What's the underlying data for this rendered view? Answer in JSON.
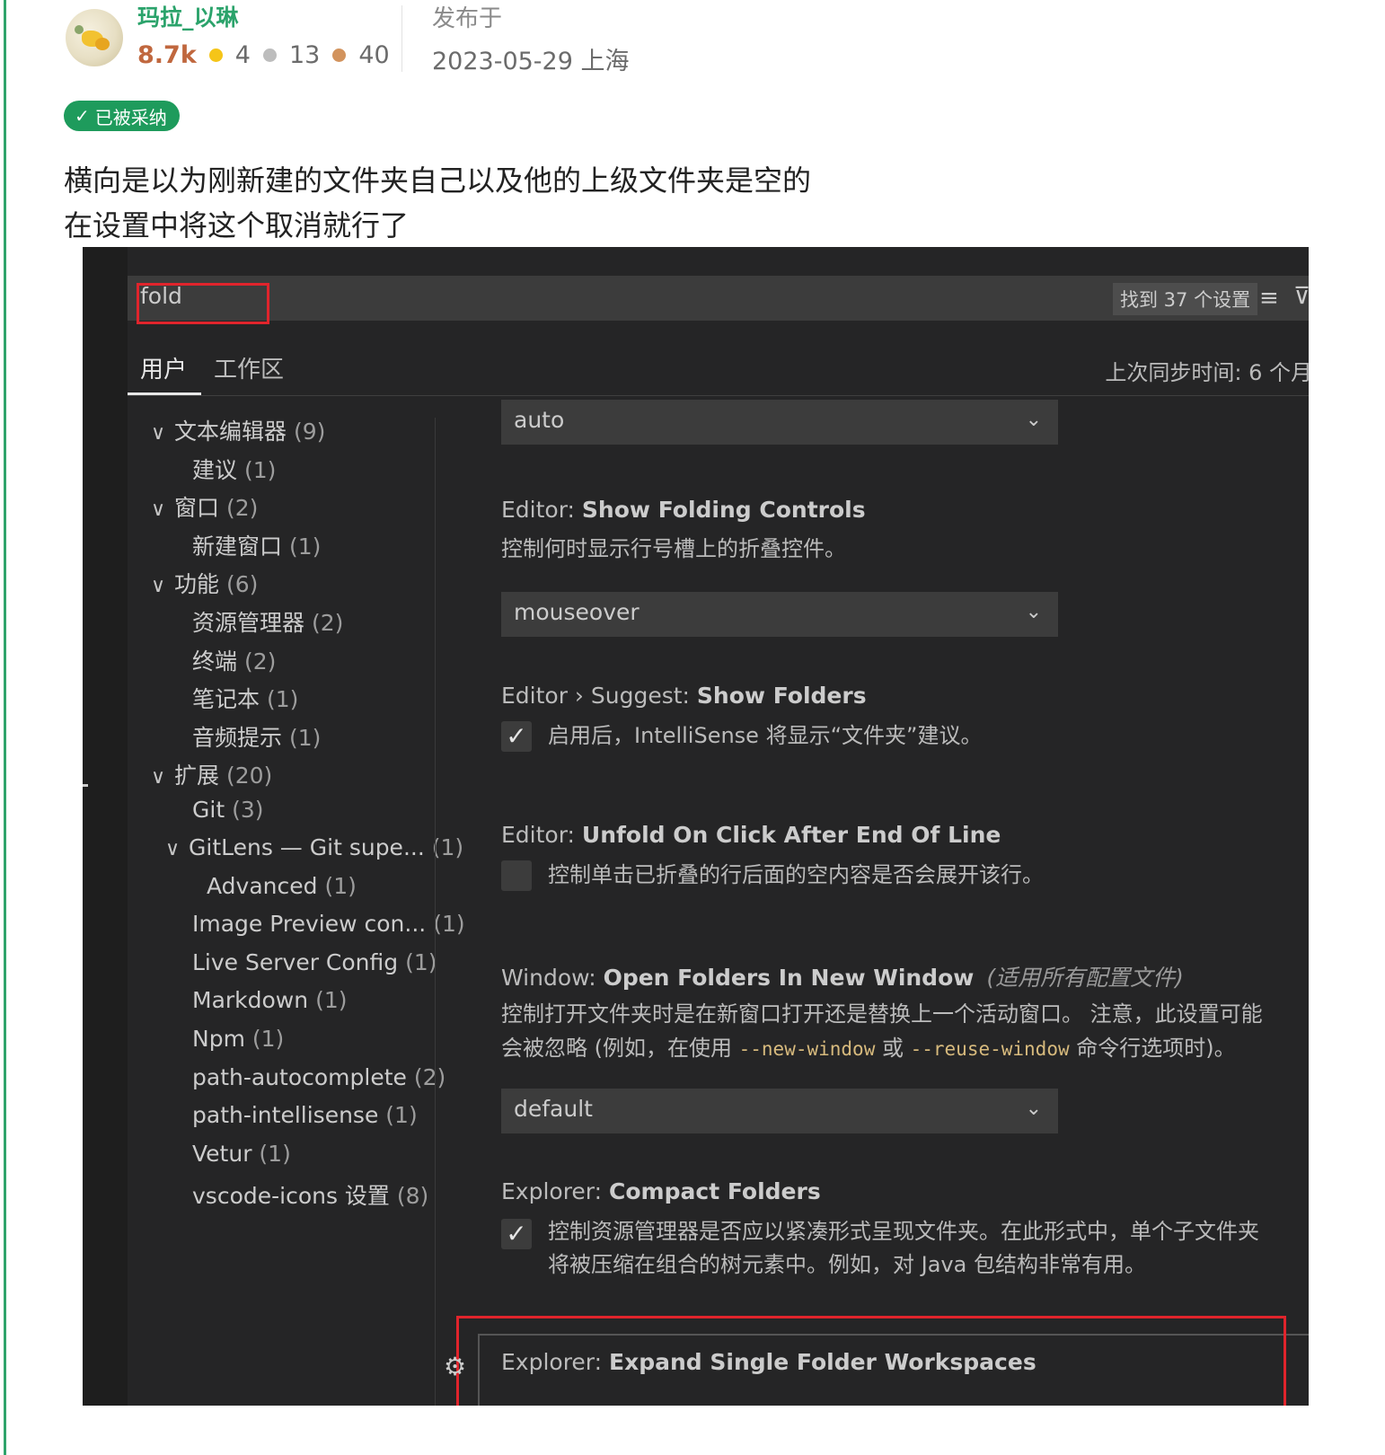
{
  "post": {
    "username": "玛拉_以琳",
    "fame": "8.7k",
    "gold": "4",
    "silver": "13",
    "bronze": "40",
    "posted_label": "发布于",
    "posted_date": "2023-05-29 上海",
    "accepted_label": "已被采纳",
    "accepted_check": "✓",
    "answer_line1": "横向是以为刚新建的文件夹自己以及他的上级文件夹是空的",
    "answer_line2": "在设置中将这个取消就行了"
  },
  "vscode": {
    "search_value": "fold",
    "found_label": "找到 37 个设置",
    "list_icon": "≡",
    "filter_icon": "⊽",
    "tabs": [
      "用户",
      "工作区"
    ],
    "sync_label": "上次同步时间: 6 个月",
    "tree": [
      {
        "label": "文本编辑器",
        "count": "(9)",
        "chevron": "∨"
      },
      {
        "label": "建议",
        "count": "(1)"
      },
      {
        "label": "窗口",
        "count": "(2)",
        "chevron": "∨"
      },
      {
        "label": "新建窗口",
        "count": "(1)"
      },
      {
        "label": "功能",
        "count": "(6)",
        "chevron": "∨"
      },
      {
        "label": "资源管理器",
        "count": "(2)"
      },
      {
        "label": "终端",
        "count": "(2)"
      },
      {
        "label": "笔记本",
        "count": "(1)"
      },
      {
        "label": "音频提示",
        "count": "(1)"
      },
      {
        "label": "扩展",
        "count": "(20)",
        "chevron": "∨"
      },
      {
        "label": "Git",
        "count": "(3)"
      },
      {
        "label": "GitLens — Git supe...",
        "count": "(1)",
        "chevron": "∨"
      },
      {
        "label": "Advanced",
        "count": "(1)"
      },
      {
        "label": "Image Preview con...",
        "count": "(1)"
      },
      {
        "label": "Live Server Config",
        "count": "(1)"
      },
      {
        "label": "Markdown",
        "count": "(1)"
      },
      {
        "label": "Npm",
        "count": "(1)"
      },
      {
        "label": "path-autocomplete",
        "count": "(2)"
      },
      {
        "label": "path-intellisense",
        "count": "(1)"
      },
      {
        "label": "Vetur",
        "count": "(1)"
      },
      {
        "label": "vscode-icons 设置",
        "count": "(8)"
      }
    ],
    "settings": {
      "dd_auto": "auto",
      "caret": "⌄",
      "s1_cat": "Editor: ",
      "s1_name": "Show Folding Controls",
      "s1_desc": "控制何时显示行号槽上的折叠控件。",
      "dd_mouseover": "mouseover",
      "s2_cat": "Editor › Suggest: ",
      "s2_name": "Show Folders",
      "s2_desc": "启用后，IntelliSense 将显示“文件夹”建议。",
      "s2_checked": "✓",
      "s3_cat": "Editor: ",
      "s3_name": "Unfold On Click After End Of Line",
      "s3_desc": "控制单击已折叠的行后面的空内容是否会展开该行。",
      "s4_cat": "Window: ",
      "s4_name": "Open Folders In New Window",
      "s4_scope": "(适用所有配置文件)",
      "s4_desc1": "控制打开文件夹时是在新窗口打开还是替换上一个活动窗口。 注意，此设置可能",
      "s4_desc2_a": "会被忽略 (例如，在使用 ",
      "s4_desc2_code1": "--new-window",
      "s4_desc2_b": " 或 ",
      "s4_desc2_code2": "--reuse-window",
      "s4_desc2_c": " 命令行选项时)。",
      "dd_default": "default",
      "s5_cat": "Explorer: ",
      "s5_name": "Compact Folders",
      "s5_desc1": "控制资源管理器是否应以紧凑形式呈现文件夹。在此形式中，单个子文件夹",
      "s5_desc2": "将被压缩在组合的树元素中。例如，对 Java 包结构非常有用。",
      "s5_checked": "✓",
      "gear_icon": "⚙",
      "s6_cat": "Explorer: ",
      "s6_name": "Expand Single Folder Workspaces"
    }
  }
}
